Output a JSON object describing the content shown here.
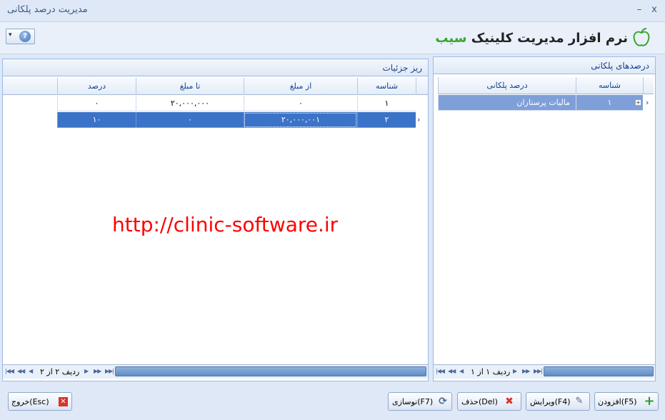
{
  "window": {
    "title": "مدیریت درصد پلکانی",
    "minimize": "–",
    "close": "x"
  },
  "logo": {
    "text_main": "نرم افزار مدیریت کلینیک ",
    "text_brand": "سیب"
  },
  "left_panel": {
    "title": "ریز جزئیات",
    "columns": [
      "شناسه",
      "از مبلغ",
      "تا مبلغ",
      "درصد"
    ],
    "rows": [
      [
        "۱",
        "۰",
        "۲۰,۰۰۰,۰۰۰",
        "۰"
      ],
      [
        "۲",
        "۲۰,۰۰۰,۰۰۱",
        "۰",
        "۱۰"
      ]
    ],
    "nav_text": "ردیف ۲ از ۲"
  },
  "right_panel": {
    "title": "درصدهای پلکانی",
    "columns": [
      "شناسه",
      "درصد پلکانی"
    ],
    "rows": [
      [
        "۱",
        "مالیات پرستاران"
      ]
    ],
    "nav_text": "ردیف ۱ از ۱"
  },
  "watermark": "http://clinic-software.ir",
  "buttons": {
    "add": "افزودن(F5)",
    "edit": "ویرایش(F4)",
    "delete": "حذف(Del)",
    "refresh": "نوسازی(F7)",
    "exit": "خروج(Esc)"
  },
  "colors": {
    "selection": "#3b73c8",
    "watermark": "#ff0000",
    "brand_green": "#3aa52f",
    "panel_border": "#99bbe8"
  }
}
